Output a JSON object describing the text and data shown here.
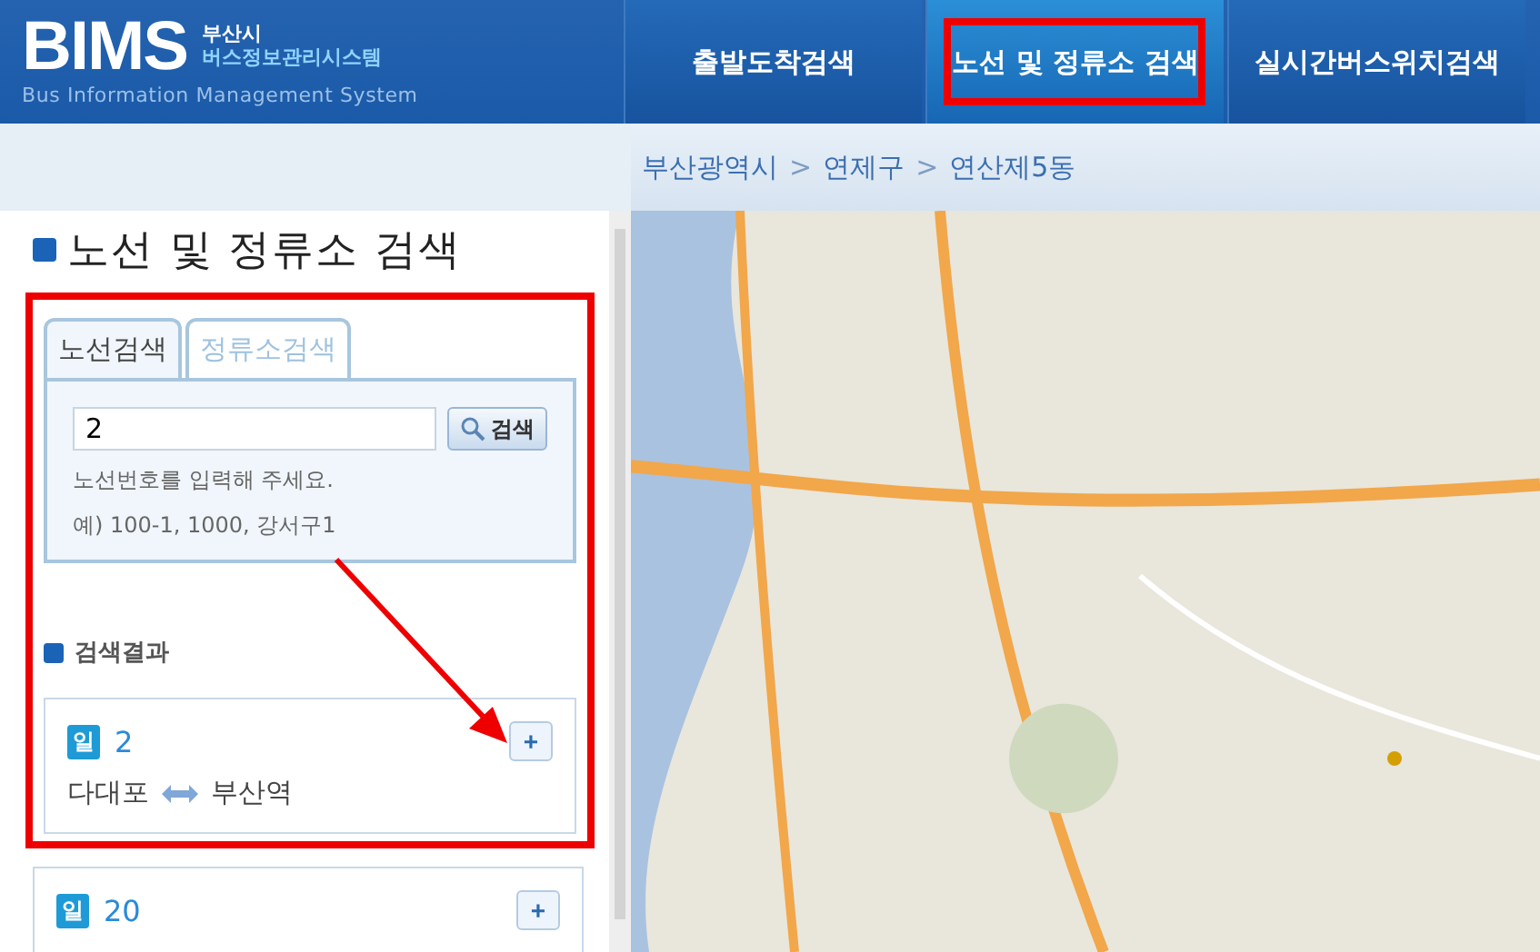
{
  "header": {
    "logo": {
      "brand": "BIMS",
      "city": "부산시",
      "system_name": "버스정보관리시스템",
      "subtitle": "Bus Information Management System"
    },
    "nav": [
      {
        "label": "출발도착검색",
        "selected": false,
        "highlighted": false
      },
      {
        "label": "노선 및 정류소 검색",
        "selected": true,
        "highlighted": true
      },
      {
        "label": "실시간버스위치검색",
        "selected": false,
        "highlighted": false
      }
    ]
  },
  "breadcrumb": {
    "items": [
      "부산광역시",
      "연제구",
      "연산제5동"
    ],
    "separator": ">"
  },
  "sidebar": {
    "title": "노선 및 정류소 검색",
    "highlighted": true,
    "annotation_arrow": true,
    "tabs": [
      {
        "label": "노선검색",
        "selected": true
      },
      {
        "label": "정류소검색",
        "selected": false
      }
    ],
    "search": {
      "value": "2",
      "button": "검색"
    },
    "help": [
      "노선번호를 입력해 주세요.",
      "예) 100-1, 1000, 강서구1"
    ],
    "results_title": "검색결과",
    "results": [
      {
        "badge": "일",
        "number": "2",
        "from": "다대포",
        "to": "부산역",
        "expand": "+"
      },
      {
        "badge": "일",
        "number": "20",
        "expand": "+"
      }
    ]
  }
}
